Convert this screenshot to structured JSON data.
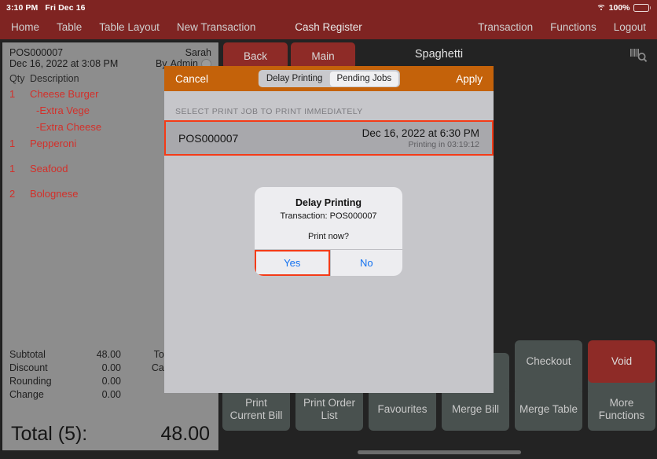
{
  "statusbar": {
    "time": "3:10 PM",
    "date": "Fri Dec 16",
    "battery": "100%"
  },
  "navbar": {
    "left_items": [
      {
        "label": "Home"
      },
      {
        "label": "Table"
      },
      {
        "label": "Table Layout"
      },
      {
        "label": "New Transaction"
      }
    ],
    "title": "Cash Register",
    "right_items": [
      {
        "label": "Transaction"
      },
      {
        "label": "Functions"
      },
      {
        "label": "Logout"
      }
    ]
  },
  "order_panel": {
    "transaction_id": "POS000007",
    "datetime": "Dec 16, 2022 at 3:08 PM",
    "staff": "Sarah",
    "by_label": "By",
    "by_user": "Admin",
    "col_qty": "Qty",
    "col_desc": "Description",
    "items": [
      {
        "qty": "1",
        "desc": "Cheese Burger",
        "mods": [
          "-Extra Vege",
          "-Extra Cheese"
        ]
      },
      {
        "qty": "1",
        "desc": "Pepperoni",
        "mods": []
      },
      {
        "qty": "1",
        "desc": "Seafood",
        "mods": []
      },
      {
        "qty": "2",
        "desc": "Bolognese",
        "mods": []
      }
    ],
    "totals_left": [
      {
        "label": "Subtotal",
        "value": "48.00"
      },
      {
        "label": "Discount",
        "value": "0.00"
      },
      {
        "label": "Rounding",
        "value": "0.00"
      },
      {
        "label": "Change",
        "value": "0.00"
      }
    ],
    "totals_right": [
      {
        "label": "Total"
      },
      {
        "label": "Cash"
      }
    ],
    "grand_label": "Total (5):",
    "grand_value": "48.00"
  },
  "menu_area": {
    "back_label": "Back",
    "main_label": "Main",
    "category_title": "Spaghetti",
    "scan_icon": "barcode-search-icon"
  },
  "actions": {
    "row_top": [
      {
        "label": "Checkout",
        "variant": "default"
      },
      {
        "label": "Void",
        "variant": "danger"
      }
    ],
    "row_bottom": [
      {
        "label": "Print\nCurrent Bill"
      },
      {
        "label": "Print Order\nList"
      },
      {
        "label": "Favourites"
      },
      {
        "label": "Merge Bill"
      },
      {
        "label": "Merge Table"
      },
      {
        "label": "More\nFunctions"
      }
    ]
  },
  "sheet": {
    "cancel_label": "Cancel",
    "apply_label": "Apply",
    "segments": [
      {
        "label": "Delay Printing",
        "selected": false
      },
      {
        "label": "Pending Jobs",
        "selected": true
      }
    ],
    "section_title": "SELECT PRINT JOB TO PRINT IMMEDIATELY",
    "job": {
      "id": "POS000007",
      "date": "Dec 16, 2022 at 6:30 PM",
      "status": "Printing in 03:19:12",
      "highlighted": true
    }
  },
  "alert": {
    "title": "Delay Printing",
    "subtitle": "Transaction: POS000007",
    "question": "Print now?",
    "yes_label": "Yes",
    "no_label": "No",
    "highlighted_button": "Yes"
  },
  "colors": {
    "nav_bar": "#7f2422",
    "sheet_header": "#c4620a",
    "panel_bg": "#8d8d8d",
    "item_text": "#d3302a",
    "highlight_border": "#f43b17",
    "alert_link": "#1472f0",
    "void_button": "#8e2b27",
    "action_button": "#49514f",
    "green_button": "#17683c"
  }
}
